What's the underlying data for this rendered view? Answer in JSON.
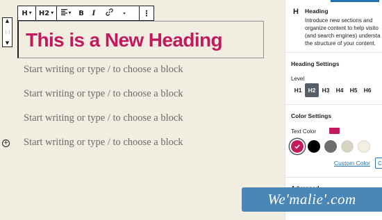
{
  "toolbar": {
    "block_type_icon": "H",
    "heading_level": "H2",
    "align_icon": "align-left-icon",
    "bold": "B",
    "italic": "I",
    "link_icon": "link-icon",
    "more_formatting": "▾",
    "more_options": "⋮"
  },
  "mover": {
    "up": "▲",
    "drag": "⋮⋮",
    "down": "▼"
  },
  "editor": {
    "heading": "This is a New Heading",
    "placeholders": [
      "Start writing or type / to choose a block",
      "Start writing or type / to choose a block",
      "Start writing or type / to choose a block",
      "Start writing or type / to choose a block"
    ],
    "inserter": "+"
  },
  "sidebar": {
    "block_card": {
      "icon": "H",
      "title": "Heading",
      "description_lines": [
        "Introduce new sections and",
        "organize content to help visito",
        "(and search engines) understa",
        "the structure of your content."
      ]
    },
    "heading_settings": {
      "title": "Heading Settings",
      "level_label": "Level",
      "levels": [
        "H1",
        "H2",
        "H3",
        "H4",
        "H5",
        "H6"
      ],
      "active_level": "H2"
    },
    "color_settings": {
      "title": "Color Settings",
      "text_color_label": "Text Color",
      "text_color_value": "#c3195d",
      "palette": [
        "#c3195d",
        "#000000",
        "#6d6d6d",
        "#d6d2c4",
        "#f4efe0"
      ],
      "custom_color_link": "Custom Color",
      "clear_button": "C"
    },
    "advanced": {
      "title": "Advanced"
    }
  },
  "watermark": {
    "text": "We'malie'.com"
  },
  "colors": {
    "accent": "#c3195d",
    "link": "#2271b1",
    "canvas": "#f1ede1",
    "watermark_bg": "#4a86b6"
  }
}
